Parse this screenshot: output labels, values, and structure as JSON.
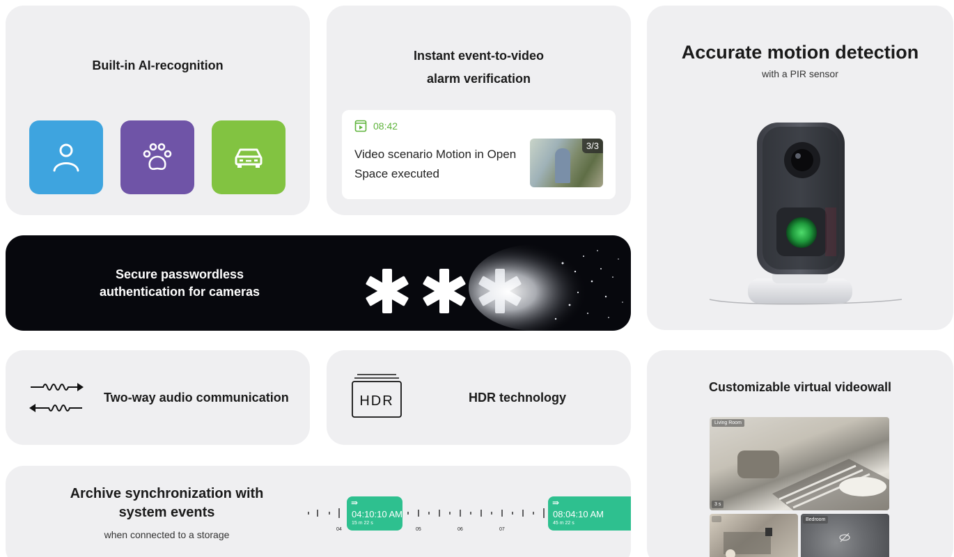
{
  "ai_card": {
    "title": "Built-in AI-recognition",
    "tiles": [
      {
        "icon": "person-icon",
        "color": "#3ea4df"
      },
      {
        "icon": "paw-icon",
        "color": "#6f54a7"
      },
      {
        "icon": "car-icon",
        "color": "#82c341"
      }
    ]
  },
  "event_card": {
    "title_line1": "Instant event-to-video",
    "title_line2": "alarm verification",
    "notification": {
      "icon": "video-play-icon",
      "time": "08:42",
      "message": "Video scenario Motion in Open Space executed",
      "thumbnail_badge": "3/3",
      "accent": "#5fb43c"
    }
  },
  "motion_card": {
    "title": "Accurate motion detection",
    "subtitle": "with a PIR sensor",
    "image": "camera-device-image"
  },
  "secure_card": {
    "title": "Secure passwordless authentication for cameras",
    "graphic": "dissolving-asterisks"
  },
  "audio_card": {
    "icon": "two-way-audio-icon",
    "label": "Two-way audio communication"
  },
  "hdr_card": {
    "icon_text": "HDR",
    "label": "HDR technology"
  },
  "videowall_card": {
    "title": "Customizable virtual videowall",
    "tiles": [
      {
        "label": "Living Room",
        "duration": "3 s"
      },
      {
        "label": "",
        "duration": ""
      },
      {
        "label": "Bedroom",
        "duration": ""
      }
    ]
  },
  "archive_card": {
    "title": "Archive synchronization with system events",
    "subtitle": "when connected to a storage",
    "timeline": {
      "hour_labels": [
        "04",
        "05",
        "06",
        "07"
      ],
      "events": [
        {
          "time": "04:10:10 AM",
          "duration": "15 m 22 s"
        },
        {
          "time": "08:04:10 AM",
          "duration": "45 m 22 s"
        }
      ],
      "accent": "#2ec08f"
    }
  }
}
